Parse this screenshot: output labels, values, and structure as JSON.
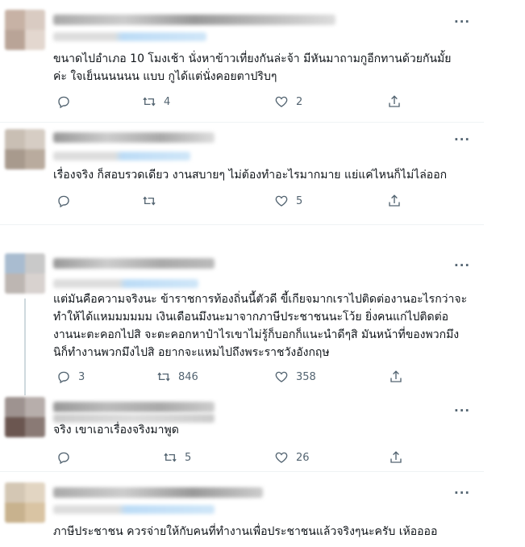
{
  "tweets": [
    {
      "more": "···",
      "text": "ขนาดไปอำเภอ 10 โมงเช้า นั่งหาข้าวเที่ยงกันล่ะจ้า มีหันมาถามกูอีกทานด้วยกันมั้ย\nค่ะ ใจเย็นนนนนน แบบ กูได้แต่นั่งคอยตาปริบๆ",
      "reply_count": "",
      "retweet_count": "4",
      "like_count": "2"
    },
    {
      "more": "···",
      "text": "เรื่องจริง ก็สอบรวดเดียว งานสบายๆ ไม่ต้องทำอะไรมากมาย แย่แค่ไหนก็ไม่ไล่ออก",
      "reply_count": "",
      "retweet_count": "",
      "like_count": "5"
    },
    {
      "more": "···",
      "text": "แต่มันคือความจริงนะ ข้าราชการท้องถิ่นนี้ตัวดี ขี้เกียจมากเราไปติดต่องานอะไรกว่าจะ\nทำให้ได้แหมมมมมม เงินเดือนมึงนะมาจากภาษีประชาชนนะโว้ย ยิ่งคนแก่ไปติดต่อ\nงานนะตะคอกไปสิ จะตะคอกหาป๋าไรเขาไม่รู้ก็บอกก็แนะนำดีๆสิ มันหน้าที่ของพวกมึง\nนิก็ทำงานพวกมึงไปสิ อยากจะแหมไปถึงพระราชวังอังกฤษ",
      "reply_count": "3",
      "retweet_count": "846",
      "like_count": "358"
    },
    {
      "more": "···",
      "text": "จริง เขาเอาเรื่องจริงมาพูด",
      "reply_count": "",
      "retweet_count": "5",
      "like_count": "26"
    },
    {
      "more": "···",
      "text": "ภาษีประชาชน ควรจ่ายให้กับคนที่ทำงานเพื่อประชาชนแล้วจริงๆนะครับ เห้ออออ",
      "reply_count": "",
      "retweet_count": "",
      "like_count": ""
    }
  ],
  "colors": {
    "text": "#0f1419",
    "icon": "#536471",
    "handle_blur": "#c9e1f5",
    "name_blur": "#b9b9b9"
  },
  "icons": {
    "reply": "reply-icon",
    "retweet": "retweet-icon",
    "like": "heart-icon",
    "share": "share-icon",
    "more": "more-options-icon"
  }
}
